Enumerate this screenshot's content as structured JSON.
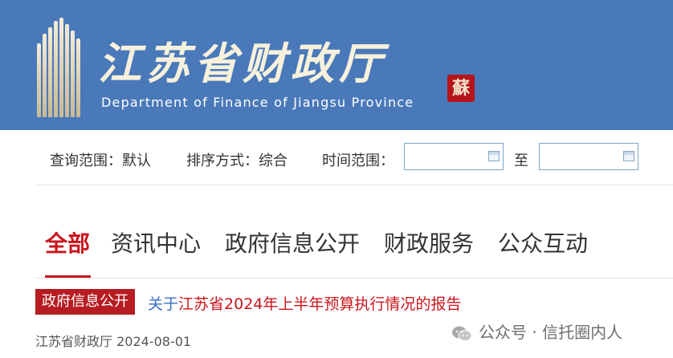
{
  "header": {
    "title_cn": "江苏省财政厅",
    "title_en": "Department of Finance of Jiangsu Province",
    "seal_char": "蘇",
    "bg_color": "#4a79ba"
  },
  "filters": {
    "scope_label": "查询范围：默认",
    "sort_label": "排序方式：综合",
    "time_label": "时间范围：",
    "to_label": "至",
    "start_date": "",
    "end_date": ""
  },
  "tabs": [
    {
      "label": "全部",
      "active": true
    },
    {
      "label": "资讯中心",
      "active": false
    },
    {
      "label": "政府信息公开",
      "active": false
    },
    {
      "label": "财政服务",
      "active": false
    },
    {
      "label": "公众互动",
      "active": false
    }
  ],
  "result": {
    "category": "政府信息公开",
    "title_prefix": "关于",
    "title_rest": "江苏省2024年上半年预算执行情况的报告",
    "source_date": "江苏省财政厅 2024-08-01"
  },
  "watermark": "公众号 · 信托圈内人",
  "colors": {
    "accent": "#c8161d",
    "link": "#3b6fc4"
  }
}
